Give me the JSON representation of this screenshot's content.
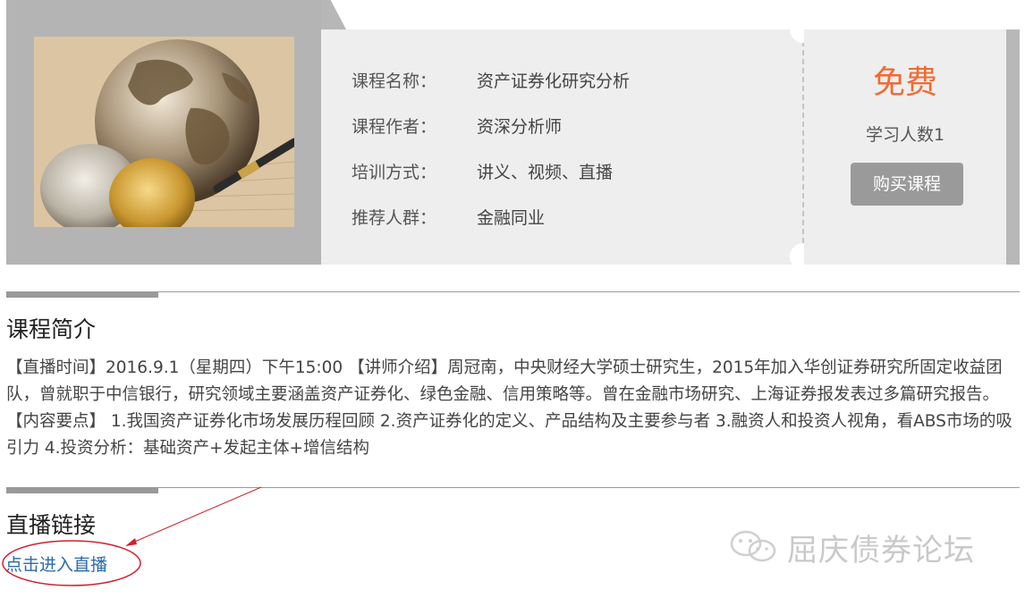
{
  "course": {
    "fields": [
      {
        "key": "课程名称：",
        "value": "资产证券化研究分析"
      },
      {
        "key": "课程作者：",
        "value": "资深分析师"
      },
      {
        "key": "培训方式：",
        "value": "讲义、视频、直播"
      },
      {
        "key": "推荐人群：",
        "value": "金融同业"
      }
    ],
    "price": "免费",
    "learners": "学习人数1",
    "buy_label": "购买课程",
    "image_icon": "globe-coins-pen-photo"
  },
  "intro": {
    "title": "课程简介",
    "text": "【直播时间】2016.9.1（星期四）下午15:00 【讲师介绍】周冠南，中央财经大学硕士研究生，2015年加入华创证券研究所固定收益团队，曾就职于中信银行，研究领域主要涵盖资产证券化、绿色金融、信用策略等。曾在金融市场研究、上海证券报发表过多篇研究报告。 【内容要点】 1.我国资产证券化市场发展历程回顾 2.资产证券化的定义、产品结构及主要参与者 3.融资人和投资人视角，看ABS市场的吸引力 4.投资分析：基础资产+发起主体+增信结构"
  },
  "live": {
    "title": "直播链接",
    "link_label": "点击进入直播"
  },
  "watermark": {
    "text": "屈庆债券论坛",
    "icon": "wechat-icon"
  },
  "colors": {
    "price": "#f06a32",
    "link": "#2a6aa8",
    "annotation": "#d0202a"
  }
}
